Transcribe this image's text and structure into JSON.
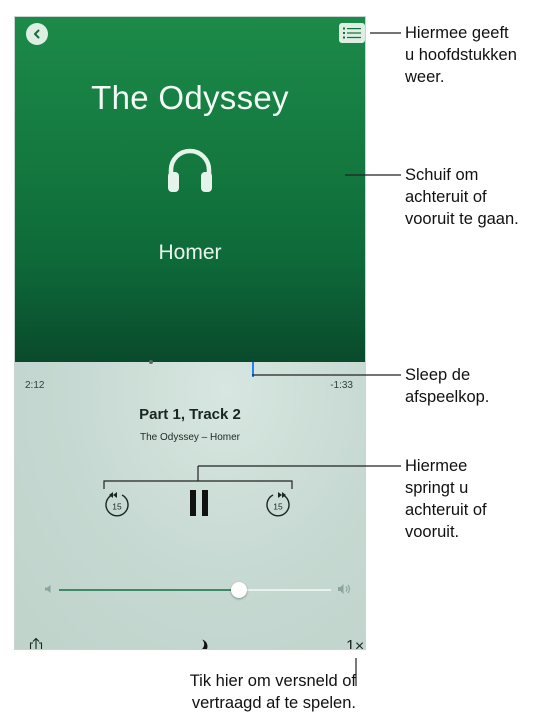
{
  "book": {
    "title": "The Odyssey",
    "author": "Homer"
  },
  "player": {
    "elapsed": "2:12",
    "remaining": "-1:33",
    "track_title": "Part 1, Track 2",
    "track_subtitle": "The Odyssey – Homer",
    "skip_back_label": "15",
    "skip_forward_label": "15",
    "speed": "1×",
    "volume_level": 0.66
  },
  "callouts": {
    "chapters": [
      "Hiermee geeft",
      "u hoofdstukken",
      "weer."
    ],
    "swipe": [
      "Schuif om",
      "achteruit of",
      "vooruit te gaan."
    ],
    "playhead": [
      "Sleep de",
      "afspeelkop."
    ],
    "skip": [
      "Hiermee",
      "springt u",
      "achteruit of",
      "vooruit."
    ],
    "speed": [
      "Tik hier om versneld of",
      "vertraagd af te spelen."
    ]
  },
  "colors": {
    "hero_top": "#1c8a49",
    "hero_bottom": "#094a2c",
    "player_bg": "#c6d9d2",
    "playhead": "#2a7ff0"
  },
  "icons": [
    "back-icon",
    "chapters-list-icon",
    "headphones-icon",
    "skip-back-15-icon",
    "pause-icon",
    "skip-forward-15-icon",
    "volume-low-icon",
    "volume-high-icon",
    "share-icon",
    "sleep-timer-moon-icon"
  ]
}
